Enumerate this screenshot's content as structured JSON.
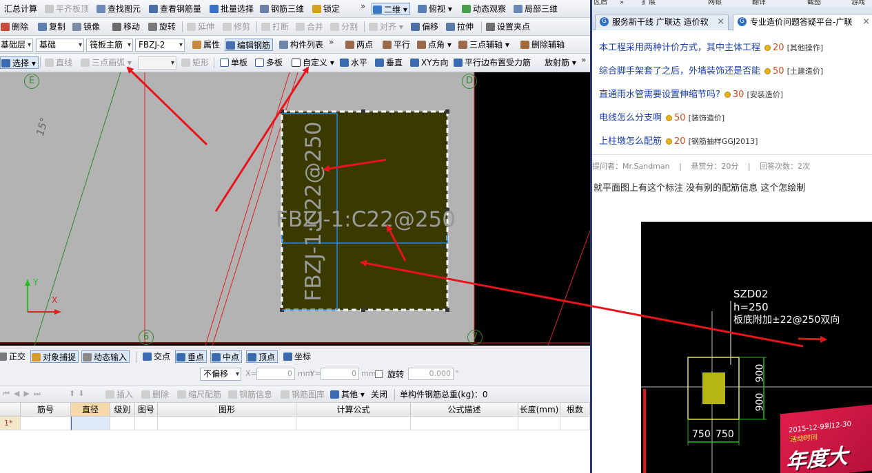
{
  "toolbar1": {
    "items": [
      "汇总计算",
      "平齐板顶",
      "查找图元",
      "查看钢筋量",
      "批量选择",
      "钢筋三维",
      "锁定",
      "二维",
      "俯视",
      "动态观察",
      "局部三维"
    ]
  },
  "toolbar2": {
    "items": [
      "删除",
      "复制",
      "镜像",
      "移动",
      "旋转",
      "延伸",
      "修剪",
      "打断",
      "合并",
      "分割",
      "对齐",
      "偏移",
      "拉伸",
      "设置夹点"
    ]
  },
  "toolbar3": {
    "layer": "基础层",
    "floor": "基础",
    "type": "筏板主筋",
    "name": "FBZJ-2",
    "items": [
      "属性",
      "编辑钢筋",
      "构件列表",
      "两点",
      "平行",
      "点角",
      "三点辅轴",
      "删除辅轴"
    ]
  },
  "toolbar4": {
    "items": [
      "选择",
      "直线",
      "三点画弧",
      "矩形",
      "单板",
      "多板",
      "自定义",
      "水平",
      "垂直",
      "XY方向",
      "平行边布置受力筋",
      "放射筋"
    ]
  },
  "drawing": {
    "grid_labels": [
      "E",
      "D",
      "6",
      "7"
    ],
    "angle_label": "15°",
    "axis_x": "X",
    "axis_y": "Y",
    "rebar_label_h": "FBZJ-1:C22@250",
    "rebar_label_v": "FBZJ-1:C22@250"
  },
  "snapbar": {
    "items": [
      "正交",
      "对象捕捉",
      "动态输入",
      "交点",
      "垂点",
      "中点",
      "顶点",
      "坐标"
    ]
  },
  "offsetbar": {
    "mode": "不偏移",
    "x_label": "X=",
    "x_value": "0",
    "y_label": "Y=",
    "y_value": "0",
    "unit": "mm",
    "rotate_label": "旋转",
    "rotate_value": "0.000",
    "degree": "°"
  },
  "gridbar": {
    "items": [
      "插入",
      "删除",
      "缩尺配筋",
      "钢筋信息",
      "钢筋图库",
      "其他",
      "关闭"
    ],
    "total_label": "单构件钢筋总重(kg)：0"
  },
  "table": {
    "headers": [
      "筋号",
      "直径(mm)",
      "级别",
      "图号",
      "图形",
      "计算公式",
      "公式描述",
      "长度(mm)",
      "根数"
    ],
    "row1": "1*"
  },
  "browser": {
    "top_fragments": [
      "区后",
      "»",
      "扩展",
      "网银",
      "翻译",
      "截图",
      "游戏"
    ],
    "tab1": "服务新干线 广联达 造价软",
    "tab2": "专业造价问题答疑平台-广联",
    "questions": [
      {
        "title": "本工程采用两种计价方式，其中主体工程",
        "points": "20",
        "category": "[其他操作]"
      },
      {
        "title": "综合脚手架套了之后，外墙装饰还是否能",
        "points": "50",
        "category": "[土建造价]"
      },
      {
        "title": "直通雨水管需要设置伸缩节吗?",
        "points": "30",
        "category": "[安装造价]"
      },
      {
        "title": "电线怎么分支啊",
        "points": "50",
        "category": "[装饰造价]"
      },
      {
        "title": "上柱墩怎么配筋",
        "points": "20",
        "category": "[钢筋抽样GGJ2013]"
      }
    ],
    "meta": {
      "asker": "提问者：Mr.Sandman",
      "reward": "悬赏分：20分",
      "answers": "回答次数：2次"
    },
    "question_body": "就平面图上有这个标注 没有别的配筋信息 这个怎绘制",
    "figure": {
      "line1": "SZD02",
      "line2": "h=250",
      "line3": "板底附加±22@250双向",
      "dim_v1": "900",
      "dim_v2": "900",
      "dim_h1": "750",
      "dim_h2": "750"
    },
    "ad": {
      "date": "2015-12-9到12-30",
      "sub": "活动时间",
      "big": "年度大"
    }
  },
  "colors": {
    "slab_fill": "#3a3a00",
    "arrow": "#e8141c",
    "grid_green": "#2f8a2f",
    "link_blue": "#1c3fa8"
  }
}
